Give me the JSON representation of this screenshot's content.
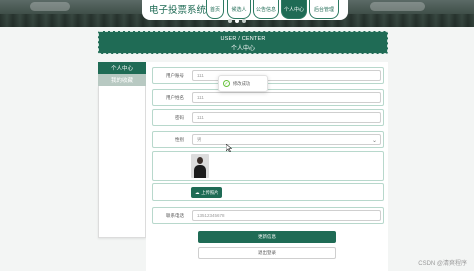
{
  "header": {
    "system_title": "电子投票系统",
    "nav": [
      {
        "label": "首页",
        "active": false
      },
      {
        "label": "候选人",
        "active": false
      },
      {
        "label": "公告信息",
        "active": false
      },
      {
        "label": "个人中心",
        "active": true
      },
      {
        "label": "后台管理",
        "active": false
      }
    ],
    "carousel_dots": 3,
    "carousel_active": 1
  },
  "banner": {
    "en": "USER / CENTER",
    "cn": "个人中心"
  },
  "sidebar": {
    "heading": "个人中心",
    "items": [
      "我的收藏"
    ]
  },
  "form": {
    "fields": [
      {
        "label": "用户账号",
        "value": "111"
      },
      {
        "label": "用户姓名",
        "value": "111"
      },
      {
        "label": "密码",
        "value": "111"
      },
      {
        "label": "性别",
        "value": "男",
        "type": "select"
      }
    ],
    "upload_label": "上传照片",
    "phone": {
      "label": "联系电话",
      "value": "13512345678"
    },
    "buttons": {
      "primary": "更新信息",
      "secondary": "退出登录"
    }
  },
  "toast": {
    "message": "修改成功"
  },
  "watermark": "CSDN @清爽程序",
  "colors": {
    "accent": "#1f6b55",
    "sidebar_inactive": "#b8c9c2",
    "success": "#67c23a"
  }
}
